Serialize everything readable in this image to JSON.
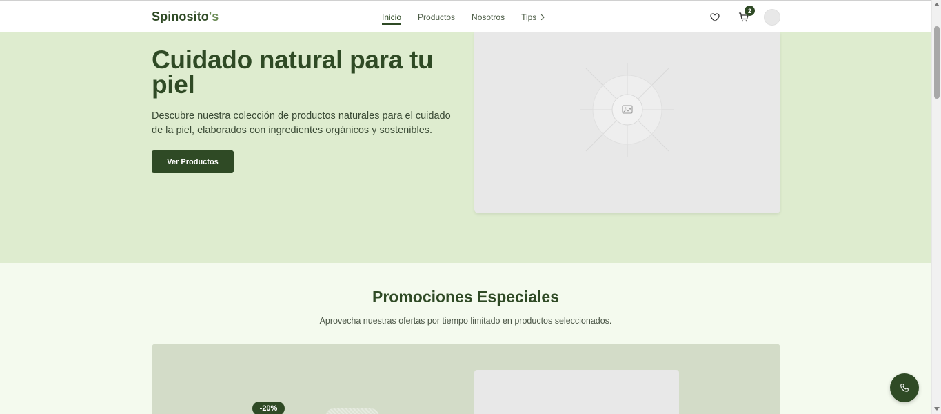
{
  "header": {
    "logo_main": "Spinosito",
    "logo_accent": "'s",
    "nav": [
      {
        "label": "Inicio",
        "active": true
      },
      {
        "label": "Productos",
        "active": false
      },
      {
        "label": "Nosotros",
        "active": false
      },
      {
        "label": "Tips",
        "active": false
      }
    ],
    "cart_count": "2",
    "icons": [
      "heart-icon",
      "cart-icon",
      "chevron-right-icon"
    ]
  },
  "hero": {
    "title": "Cuidado natural para tu piel",
    "text": "Descubre nuestra colección de productos naturales para el cuidado de la piel, elaborados con ingredientes orgánicos y sostenibles.",
    "button": "Ver Productos",
    "image_icon": "image-placeholder-icon"
  },
  "promotions": {
    "title": "Promociones Especiales",
    "subtitle": "Aprovecha nuestras ofertas por tiempo limitado en productos seleccionados.",
    "badge": "-20%"
  },
  "fab": {
    "icon": "phone-icon"
  },
  "colors": {
    "primary": "#2f4a25",
    "hero_bg": "#deeccf",
    "page_bg": "#f4faee",
    "promo_bg": "#d3dcc8"
  }
}
